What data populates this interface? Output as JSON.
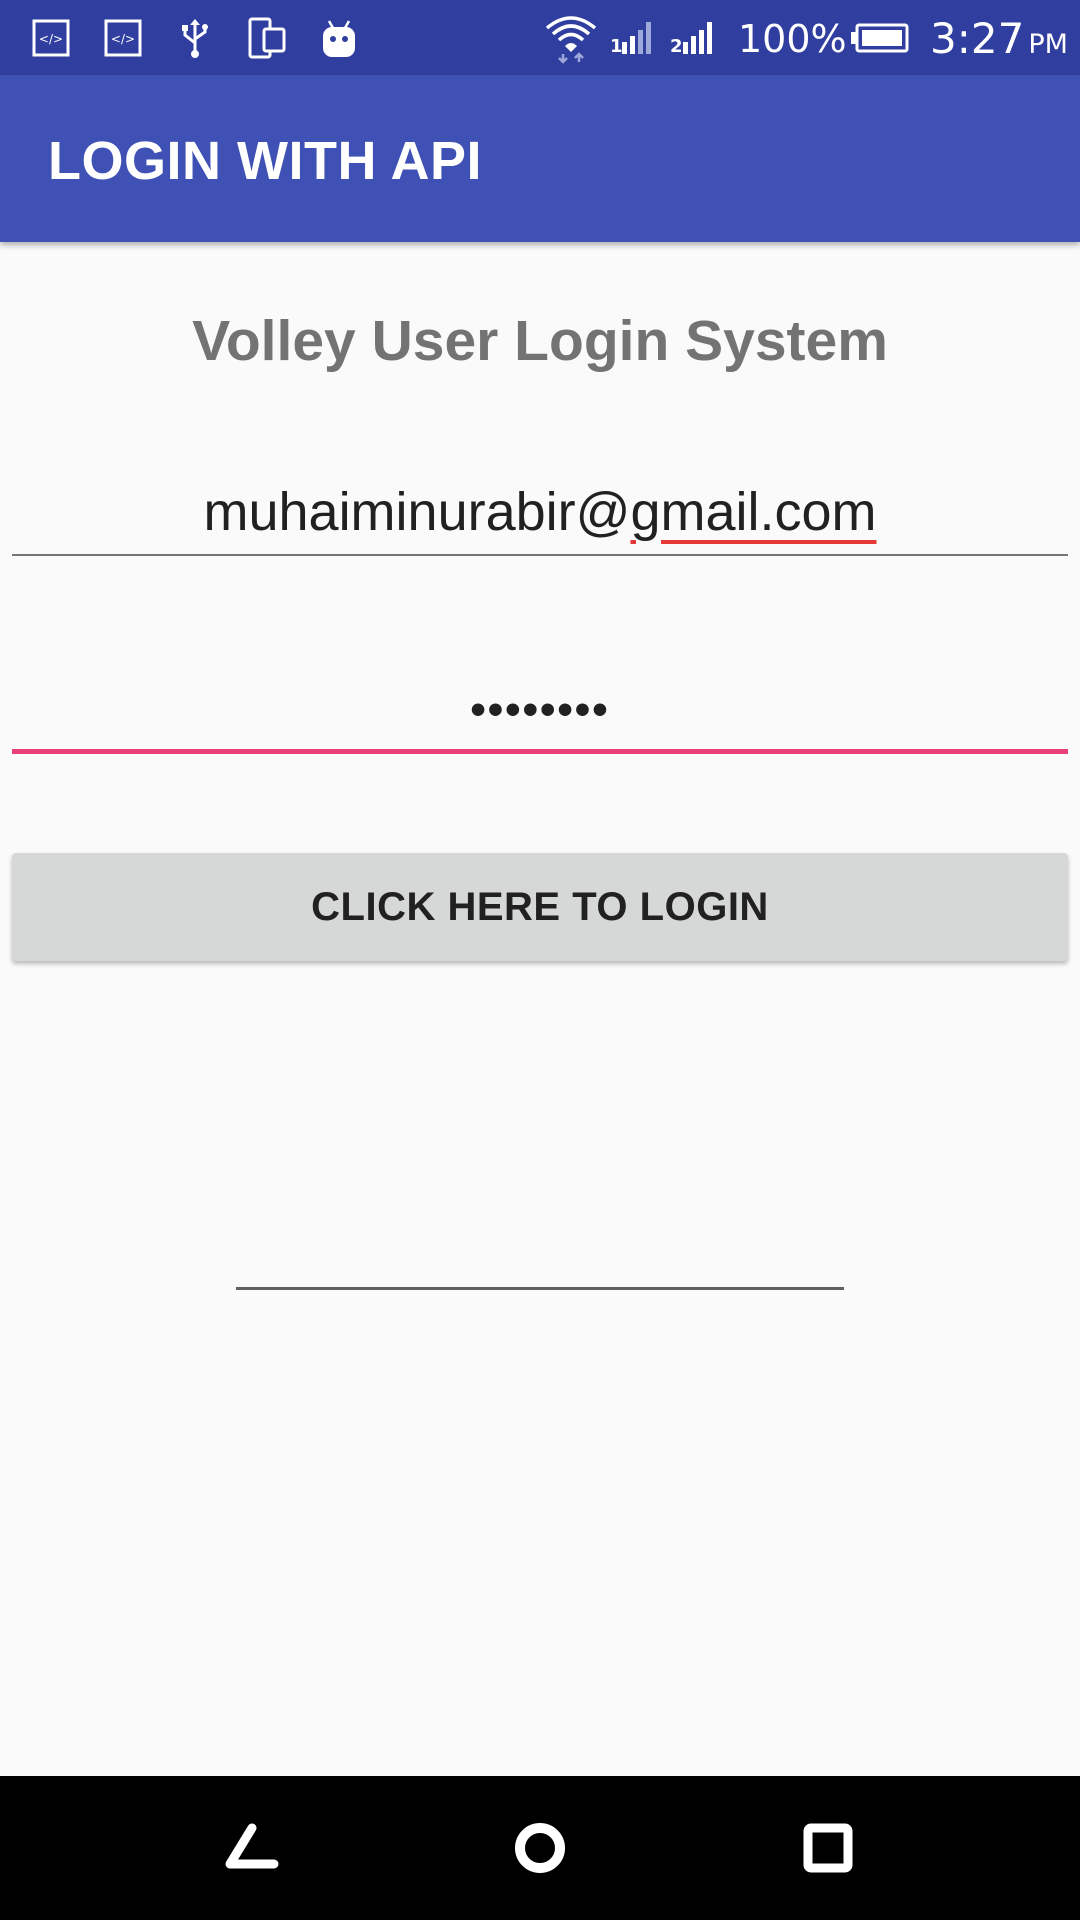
{
  "status_bar": {
    "icons": [
      "code-icon",
      "code-icon",
      "usb-icon",
      "device-icon",
      "android-icon",
      "wifi-icon",
      "signal-1-icon",
      "signal-2-icon",
      "battery-icon"
    ],
    "battery_percent": "100%",
    "time": "3:27",
    "ampm": "PM"
  },
  "app_bar": {
    "title": "LOGIN WITH API"
  },
  "main": {
    "heading": "Volley User Login System",
    "email": {
      "value_prefix": "muhaiminurabir@",
      "value_flagged": "gmail.com"
    },
    "password": {
      "value": "••••••••"
    },
    "login_button": {
      "label": "CLICK HERE TO LOGIN"
    },
    "result_field": {
      "value": ""
    }
  },
  "nav_bar": {
    "icons": [
      "back-icon",
      "home-icon",
      "recents-icon"
    ]
  },
  "colors": {
    "status_bar": "#303f9f",
    "app_bar": "#3f51b5",
    "accent": "#ec407a",
    "spellcheck": "#e53935",
    "button": "#d6d7d7",
    "background": "#fafafa"
  }
}
